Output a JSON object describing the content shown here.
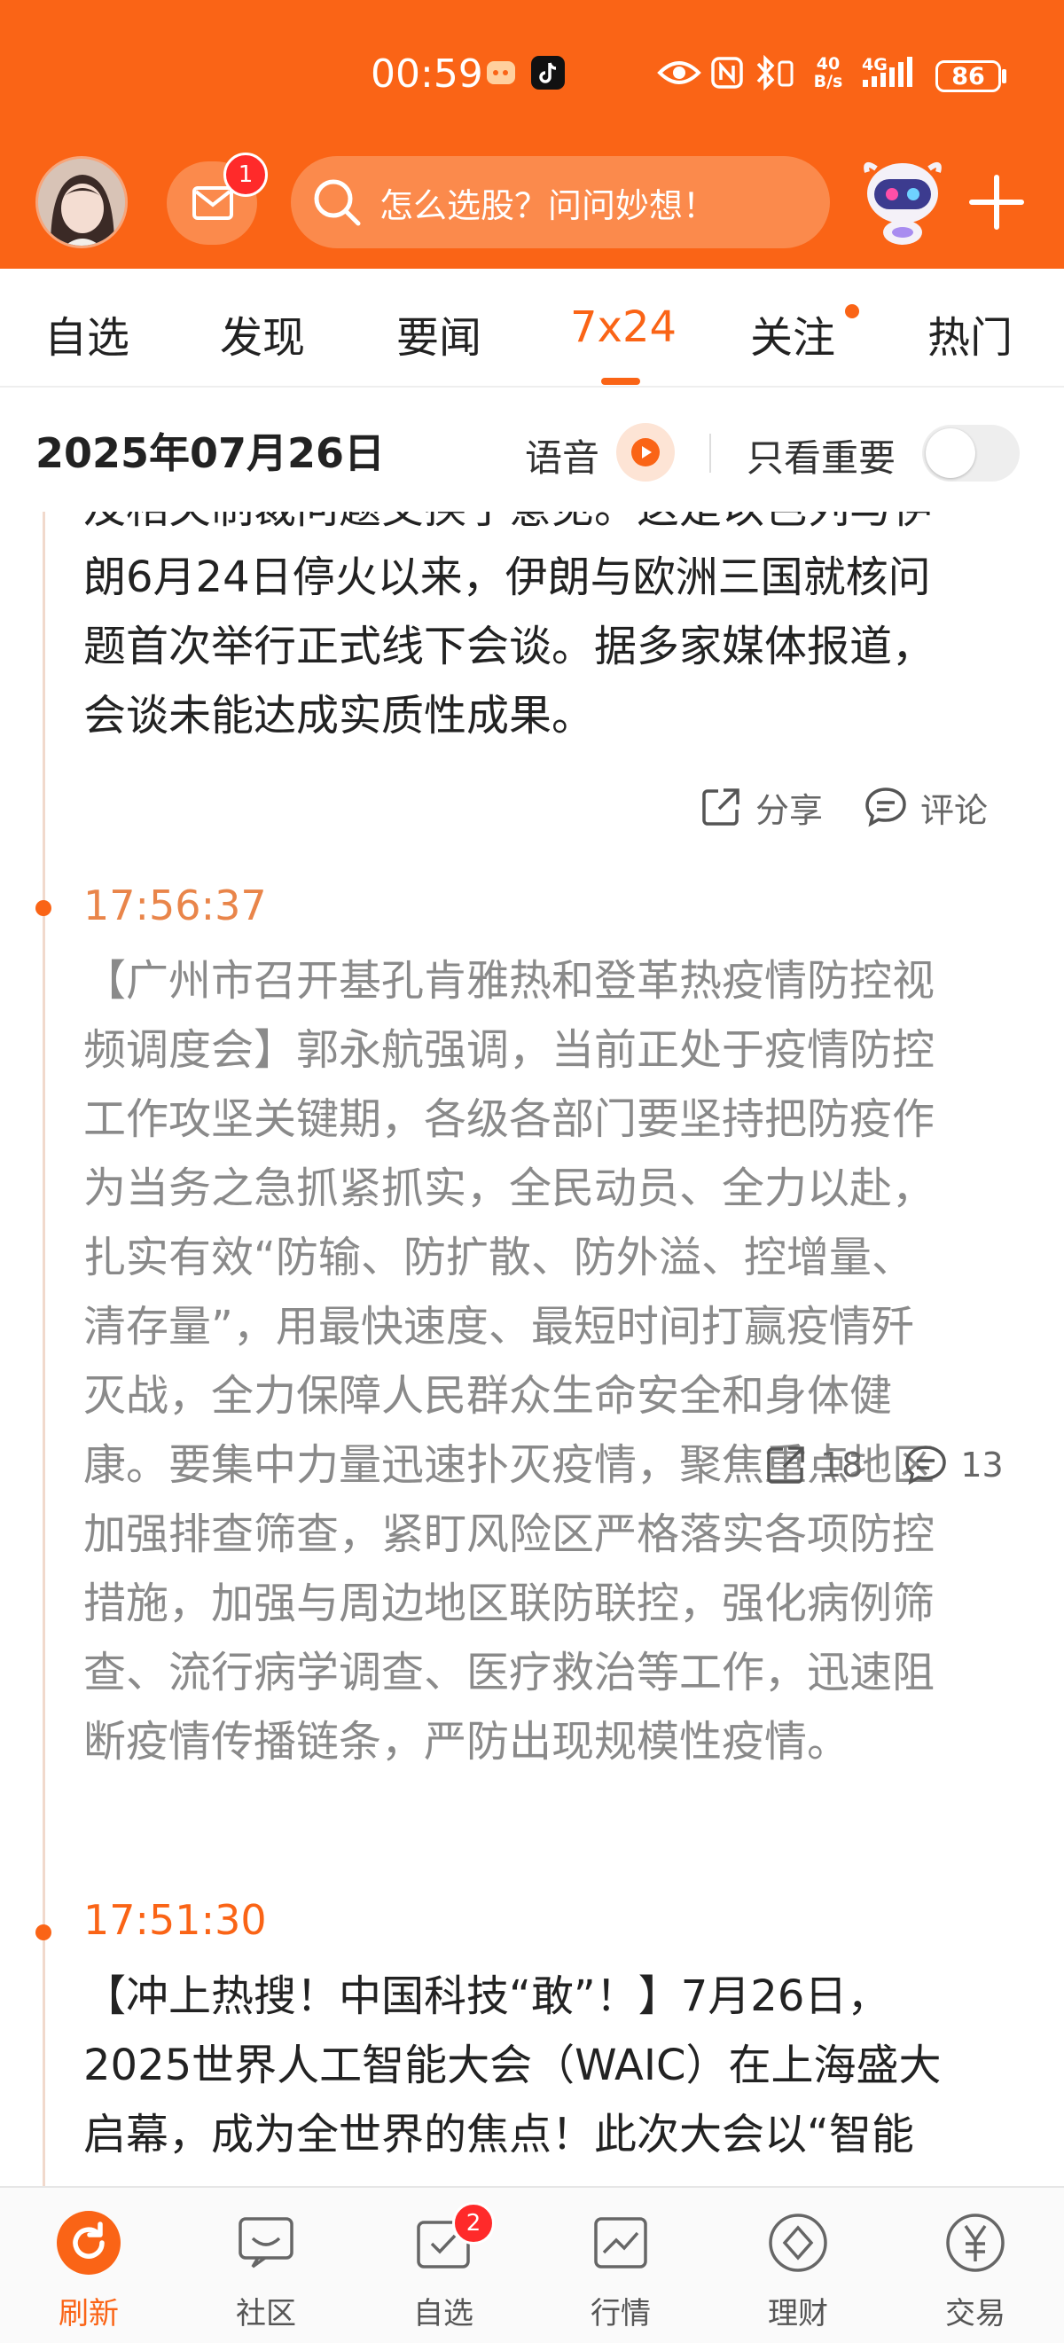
{
  "status_bar": {
    "time": "00:59",
    "net_speed_top": "40",
    "net_speed_bottom": "B/s",
    "network": "4G",
    "battery": "86"
  },
  "header": {
    "mail_badge": "1",
    "search_placeholder": "怎么选股？问问妙想！"
  },
  "tabs": [
    {
      "label": "自选"
    },
    {
      "label": "发现"
    },
    {
      "label": "要闻"
    },
    {
      "label": "7x24",
      "active": true
    },
    {
      "label": "关注",
      "has_dot": true
    },
    {
      "label": "热门"
    }
  ],
  "datebar": {
    "date": "2025年07月26日",
    "voice_label": "语音",
    "important_only_label": "只看重要",
    "important_only_on": false
  },
  "feed": {
    "partial_item": {
      "lines": [
        "及相关制裁问题交换了意见。这是以色列与伊",
        "朗6月24日停火以来，伊朗与欧洲三国就核问",
        "题首次举行正式线下会谈。据多家媒体报道，",
        "会谈未能达成实质性成果。"
      ],
      "share_label": "分享",
      "comment_label": "评论"
    },
    "item1": {
      "time": "17:56:37",
      "lines": [
        "【广州市召开基孔肯雅热和登革热疫情防控视",
        "频调度会】郭永航强调，当前正处于疫情防控",
        "工作攻坚关键期，各级各部门要坚持把防疫作",
        "为当务之急抓紧抓实，全民动员、全力以赴，",
        "扎实有效“防输、防扩散、防外溢、控增量、",
        "清存量”，用最快速度、最短时间打赢疫情歼",
        "灭战，全力保障人民群众生命安全和身体健",
        "康。要集中力量迅速扑灭疫情，聚焦重点地区",
        "加强排查筛查，紧盯风险区严格落实各项防控",
        "措施，加强与周边地区联防联控，强化病例筛",
        "查、流行病学调查、医疗救治等工作，迅速阻",
        "断疫情传播链条，严防出现规模性疫情。"
      ],
      "share_count": "18",
      "comment_count": "13"
    },
    "item2": {
      "time": "17:51:30",
      "lines": [
        "【冲上热搜！中国科技“敢”！】7月26日，",
        "2025世界人工智能大会（WAIC）在上海盛大",
        "启幕，成为全世界的焦点！此次大会以“智能"
      ]
    }
  },
  "bottom_nav": [
    {
      "label": "刷新",
      "icon": "refresh-icon",
      "active": true
    },
    {
      "label": "社区",
      "icon": "community-icon"
    },
    {
      "label": "自选",
      "icon": "watchlist-icon",
      "badge": "2"
    },
    {
      "label": "行情",
      "icon": "market-icon"
    },
    {
      "label": "理财",
      "icon": "wealth-icon"
    },
    {
      "label": "交易",
      "icon": "trade-icon"
    }
  ],
  "colors": {
    "brand": "#fa6416",
    "read_text": "#8a8a8a",
    "body_text": "#222222"
  }
}
